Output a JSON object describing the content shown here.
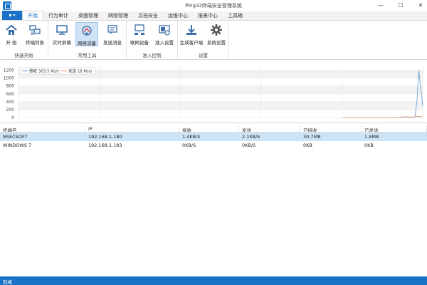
{
  "window": {
    "title": "Ping32终端安全管理系统"
  },
  "menu": {
    "label": "▪ ▾"
  },
  "tabs": [
    {
      "label": "开始",
      "active": true
    },
    {
      "label": "行为审计"
    },
    {
      "label": "桌面管理"
    },
    {
      "label": "网络管理"
    },
    {
      "label": "文档安全"
    },
    {
      "label": "运维中心"
    },
    {
      "label": "报表中心"
    },
    {
      "label": "工具箱"
    }
  ],
  "ribbon": {
    "groups": [
      {
        "label": "快速开始",
        "buttons": [
          {
            "label": "开  始",
            "icon": "home-icon"
          },
          {
            "label": "终端列表",
            "icon": "terminal-list-icon"
          }
        ]
      },
      {
        "label": "常用工具",
        "buttons": [
          {
            "label": "实时屏幕",
            "icon": "monitor-icon"
          },
          {
            "label": "网络流量",
            "icon": "network-traffic-icon",
            "active": true
          },
          {
            "label": "发送消息",
            "icon": "message-icon"
          }
        ]
      },
      {
        "label": "准入控制",
        "buttons": [
          {
            "label": "联网设备",
            "icon": "network-device-icon"
          },
          {
            "label": "准入设置",
            "icon": "access-settings-icon"
          }
        ]
      },
      {
        "label": "设置",
        "buttons": [
          {
            "label": "生成客户端",
            "icon": "download-icon"
          },
          {
            "label": "系统设置",
            "icon": "gear-icon"
          }
        ]
      }
    ]
  },
  "chart_data": {
    "type": "line",
    "yticks": [
      0,
      200,
      400,
      600,
      800,
      1000,
      1200
    ],
    "ylim": [
      0,
      1300
    ],
    "grid": true,
    "legend_position": "top-left",
    "series": [
      {
        "name": "接收 303.5 Kb/s",
        "color": "#7ba7d9",
        "values": [
          0,
          0,
          0,
          0,
          0,
          0,
          0,
          0,
          0,
          0,
          0,
          0,
          0,
          0,
          0,
          0,
          0,
          0,
          0,
          0,
          0,
          0,
          0,
          0,
          0,
          0,
          0,
          0,
          0,
          0,
          0,
          0,
          0,
          0,
          0,
          0,
          0,
          0,
          0,
          0,
          0,
          0,
          0,
          0,
          0,
          0,
          0,
          0,
          0,
          0,
          0,
          0,
          0,
          0,
          0,
          0,
          0,
          0,
          0,
          0,
          0,
          0,
          0,
          0,
          0,
          0,
          0,
          0,
          0,
          0,
          0,
          0,
          0,
          0,
          0,
          0,
          0,
          0,
          0,
          0,
          0,
          0,
          0,
          0,
          0,
          0,
          0,
          0,
          0,
          0,
          0,
          0,
          0,
          0,
          0,
          0,
          0,
          0,
          0,
          0,
          0,
          0,
          0,
          0,
          0,
          0,
          0,
          0,
          0,
          0,
          0,
          0,
          0,
          0,
          0,
          0,
          0,
          0,
          0,
          0,
          0,
          0,
          0,
          0,
          0,
          0,
          0,
          0,
          0,
          0,
          0,
          0,
          0,
          0,
          0,
          0,
          0,
          0,
          0,
          0,
          0,
          0,
          0,
          0,
          0,
          0,
          0,
          0,
          0,
          0,
          0,
          0,
          0,
          0,
          0,
          0,
          0,
          0,
          0,
          0,
          0,
          0,
          0,
          0,
          0,
          0,
          0,
          0,
          0,
          0,
          0,
          0,
          0,
          0,
          0,
          0,
          0,
          0,
          0,
          0,
          0,
          0,
          0,
          0,
          0,
          0,
          0,
          0,
          0,
          0,
          0,
          0,
          0,
          0,
          0,
          0,
          0,
          5,
          20,
          10,
          15,
          5,
          10,
          5,
          20,
          400,
          1200,
          700,
          300
        ]
      },
      {
        "name": "发送 18 Kb/s",
        "color": "#e3a27a",
        "values": [
          0,
          0,
          0,
          0,
          0,
          0,
          0,
          0,
          0,
          0,
          0,
          0,
          0,
          0,
          0,
          0,
          0,
          0,
          0,
          0,
          0,
          0,
          0,
          0,
          0,
          0,
          0,
          0,
          0,
          0,
          0,
          0,
          0,
          0,
          0,
          0,
          0,
          0,
          0,
          0,
          0,
          0,
          0,
          0,
          0,
          0,
          0,
          0,
          0,
          0,
          0,
          0,
          0,
          0,
          0,
          0,
          0,
          0,
          0,
          0,
          0,
          0,
          0,
          0,
          0,
          0,
          0,
          0,
          0,
          0,
          0,
          0,
          0,
          0,
          0,
          0,
          0,
          0,
          0,
          0,
          0,
          0,
          0,
          0,
          0,
          0,
          0,
          0,
          0,
          0,
          0,
          0,
          0,
          0,
          0,
          0,
          0,
          0,
          0,
          0,
          0,
          0,
          0,
          0,
          0,
          0,
          0,
          0,
          0,
          0,
          0,
          0,
          0,
          0,
          0,
          0,
          0,
          0,
          0,
          0,
          0,
          0,
          0,
          0,
          0,
          0,
          0,
          0,
          0,
          0,
          0,
          0,
          0,
          0,
          0,
          0,
          0,
          0,
          0,
          0,
          0,
          0,
          0,
          0,
          0,
          0,
          0,
          0,
          0,
          0,
          0,
          0,
          0,
          0,
          0,
          0,
          0,
          0,
          0,
          0,
          0,
          0,
          0,
          0,
          0,
          0,
          0,
          0,
          0,
          0,
          0,
          0,
          0,
          0,
          0,
          0,
          0,
          0,
          0,
          0,
          0,
          0,
          0,
          0,
          0,
          0,
          0,
          0,
          0,
          0,
          0,
          0,
          0,
          0,
          0,
          0,
          10,
          15,
          12,
          18,
          10,
          15,
          12,
          20,
          30,
          25,
          20,
          18
        ]
      }
    ]
  },
  "table": {
    "columns": [
      "终端名",
      "IP",
      "接收",
      "发送",
      "已接收",
      "已发送"
    ],
    "rows": [
      {
        "cells": [
          "NSECSOFT",
          "192.168.1.180",
          "1.4KB/S",
          "2.1KB/S",
          "30.7MB",
          "1.8MB"
        ],
        "selected": true
      },
      {
        "cells": [
          "WINDOWS 7",
          "192.168.1.183",
          "0KB/S",
          "0KB/S",
          "0KB",
          "0KB"
        ]
      }
    ]
  },
  "status": {
    "text": "就绪"
  },
  "colors": {
    "accent": "#1a72c8",
    "selected_row": "#cce4f7",
    "ribbon_active": "#cfe2f6"
  }
}
